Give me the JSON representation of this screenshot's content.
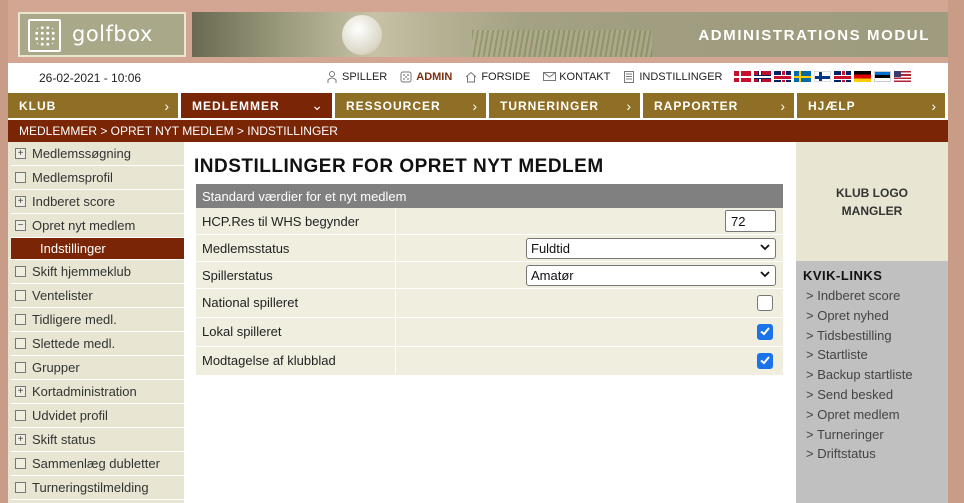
{
  "header": {
    "logo_text": "golfbox",
    "module_title": "ADMINISTRATIONS MODUL"
  },
  "infobar": {
    "datetime": "26-02-2021 - 10:06",
    "links": [
      {
        "label": "SPILLER",
        "icon": "person-icon"
      },
      {
        "label": "ADMIN",
        "icon": "golfball-icon"
      },
      {
        "label": "FORSIDE",
        "icon": "home-icon"
      },
      {
        "label": "KONTAKT",
        "icon": "mail-icon"
      },
      {
        "label": "INDSTILLINGER",
        "icon": "document-icon"
      }
    ],
    "flags": [
      "denmark",
      "norway",
      "united-kingdom",
      "sweden",
      "finland",
      "united-kingdom",
      "germany",
      "estonia",
      "united-states"
    ]
  },
  "nav": {
    "items": [
      {
        "label": "KLUB",
        "chevron": "›"
      },
      {
        "label": "MEDLEMMER",
        "chevron": "⌄"
      },
      {
        "label": "RESSOURCER",
        "chevron": "›"
      },
      {
        "label": "TURNERINGER",
        "chevron": "›"
      },
      {
        "label": "RAPPORTER",
        "chevron": "›"
      },
      {
        "label": "HJÆLP",
        "chevron": "›"
      }
    ]
  },
  "breadcrumb": "MEDLEMMER > OPRET NYT MEDLEM > INDSTILLINGER",
  "sidebar": {
    "items": [
      {
        "label": "Medlemssøgning",
        "box": "+"
      },
      {
        "label": "Medlemsprofil",
        "box": ""
      },
      {
        "label": "Indberet score",
        "box": "+"
      },
      {
        "label": "Opret nyt medlem",
        "box": "−"
      },
      {
        "label": "Indstillinger",
        "box": ""
      },
      {
        "label": "Skift hjemmeklub",
        "box": ""
      },
      {
        "label": "Ventelister",
        "box": ""
      },
      {
        "label": "Tidligere medl.",
        "box": ""
      },
      {
        "label": "Slettede medl.",
        "box": ""
      },
      {
        "label": "Grupper",
        "box": ""
      },
      {
        "label": "Kortadministration",
        "box": "+"
      },
      {
        "label": "Udvidet profil",
        "box": ""
      },
      {
        "label": "Skift status",
        "box": "+"
      },
      {
        "label": "Sammenlæg dubletter",
        "box": ""
      },
      {
        "label": "Turneringstilmelding",
        "box": ""
      }
    ]
  },
  "main": {
    "title": "INDSTILLINGER FOR OPRET NYT MEDLEM",
    "section_header": "Standard værdier for et nyt medlem",
    "rows": {
      "hcp_label": "HCP.Res til WHS begynder",
      "hcp_value": "72",
      "medlemsstatus_label": "Medlemsstatus",
      "medlemsstatus_value": "Fuldtid",
      "spillerstatus_label": "Spillerstatus",
      "spillerstatus_value": "Amatør",
      "national_label": "National spilleret",
      "lokal_label": "Lokal spilleret",
      "klubblad_label": "Modtagelse af klubblad"
    },
    "checkboxes": {
      "national": false,
      "lokal": true,
      "klubblad": true
    }
  },
  "rightcol": {
    "logo_missing_line1": "KLUB LOGO",
    "logo_missing_line2": "MANGLER",
    "kvik_title": "KVIK-LINKS",
    "kvik_links": [
      "> Indberet score",
      "> Opret nyhed",
      "> Tidsbestilling",
      "> Startliste",
      "> Backup startliste",
      "> Send besked",
      "> Opret medlem",
      "> Turneringer",
      "> Driftstatus"
    ]
  },
  "colors": {
    "brand_dark": "#7a2505",
    "nav_gold": "#8e6f25",
    "sidebar_bg": "#e8e6d3",
    "checkbox_blue": "#1a73e8"
  }
}
